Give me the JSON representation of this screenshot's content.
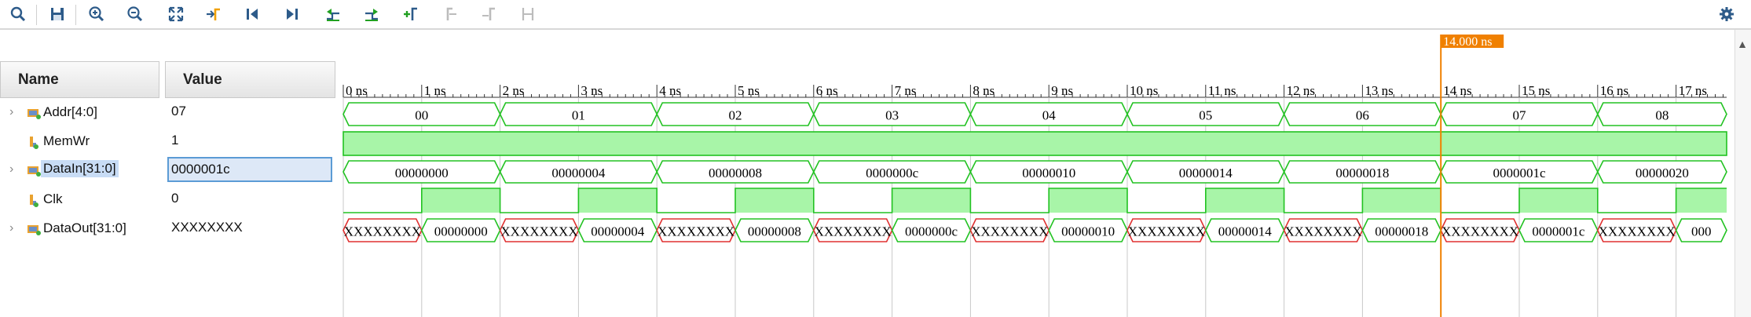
{
  "toolbar": {
    "buttons": [
      "search-icon",
      "save-icon",
      "zoom-in-icon",
      "zoom-out-icon",
      "zoom-fit-icon",
      "go-to-cursor-icon",
      "go-to-time-0-icon",
      "go-to-last-time-icon",
      "previous-transition-icon",
      "next-transition-icon",
      "add-marker-icon",
      "previous-marker-icon",
      "next-marker-icon",
      "swap-cursors-icon"
    ],
    "settings_icon": "gear-icon"
  },
  "columns": {
    "name": "Name",
    "value": "Value"
  },
  "signals": [
    {
      "name": "Addr[4:0]",
      "value": "07",
      "bus": true,
      "selected": false
    },
    {
      "name": "MemWr",
      "value": "1",
      "bus": false,
      "selected": false
    },
    {
      "name": "DataIn[31:0]",
      "value": "0000001c",
      "bus": true,
      "selected": true
    },
    {
      "name": "Clk",
      "value": "0",
      "bus": false,
      "selected": false
    },
    {
      "name": "DataOut[31:0]",
      "value": "XXXXXXXX",
      "bus": true,
      "selected": false
    }
  ],
  "timeline": {
    "unit": "ns",
    "labels": [
      "0 ns",
      "1 ns",
      "2 ns",
      "3 ns",
      "4 ns",
      "5 ns",
      "6 ns",
      "7 ns",
      "8 ns",
      "9 ns",
      "10 ns",
      "11 ns",
      "12 ns",
      "13 ns",
      "14 ns",
      "15 ns",
      "16 ns",
      "17 ns"
    ],
    "cursor_label": "14.000 ns",
    "cursor_time": 14
  },
  "waves": {
    "addr": [
      "00",
      "01",
      "02",
      "03",
      "04",
      "05",
      "06",
      "07",
      "08"
    ],
    "datain": [
      "00000000",
      "00000004",
      "00000008",
      "0000000c",
      "00000010",
      "00000014",
      "00000018",
      "0000001c",
      "00000020"
    ],
    "dataout": [
      "XXXXXXXX",
      "00000000",
      "XXXXXXXX",
      "00000004",
      "XXXXXXXX",
      "00000008",
      "XXXXXXXX",
      "0000000c",
      "XXXXXXXX",
      "00000010",
      "XXXXXXXX",
      "00000014",
      "XXXXXXXX",
      "00000018",
      "XXXXXXXX",
      "0000001c",
      "XXXXXXXX",
      "000"
    ],
    "memwr": 1,
    "clk_period": 2
  },
  "colors": {
    "wave": "#22c222",
    "wave_fill": "#a8f5a8",
    "undefined": "#e03030",
    "cursor": "#f08000",
    "grid": "#c8c8c8"
  }
}
